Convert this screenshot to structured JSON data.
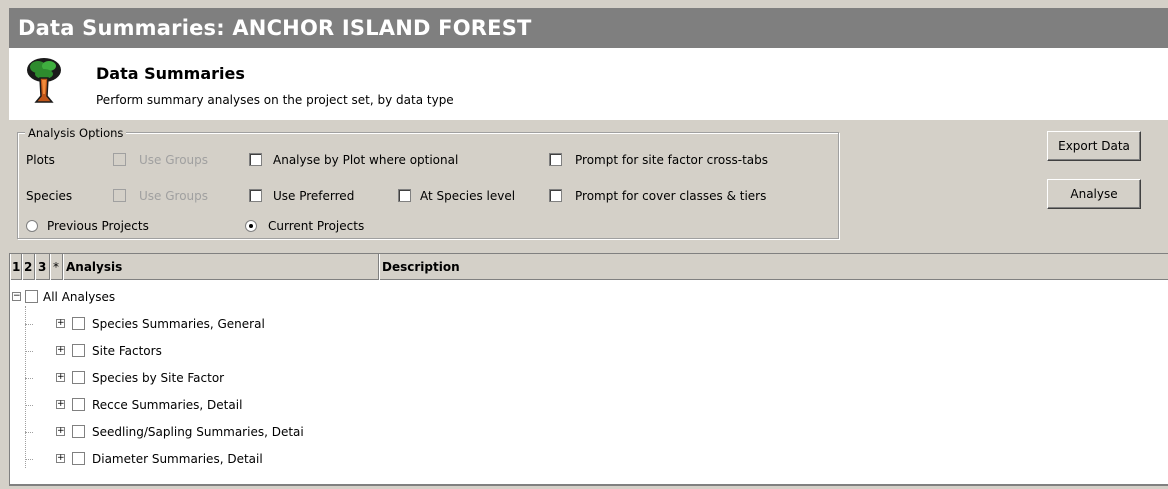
{
  "window": {
    "title": "Data Summaries: ANCHOR ISLAND FOREST"
  },
  "header": {
    "icon": "tree-icon",
    "title": "Data Summaries",
    "subtitle": "Perform summary analyses on the project set, by data type"
  },
  "options": {
    "legend": "Analysis Options",
    "plots_label": "Plots",
    "species_label": "Species",
    "plots_use_groups": {
      "label": "Use Groups",
      "checked": false,
      "enabled": false
    },
    "analyse_by_plot": {
      "label": "Analyse by Plot where optional",
      "checked": false
    },
    "prompt_site_factor": {
      "label": "Prompt for site factor cross-tabs",
      "checked": false
    },
    "species_use_groups": {
      "label": "Use Groups",
      "checked": false,
      "enabled": false
    },
    "use_preferred": {
      "label": "Use Preferred",
      "checked": false
    },
    "at_species_level": {
      "label": "At Species level",
      "checked": false
    },
    "prompt_cover": {
      "label": "Prompt for cover classes & tiers",
      "checked": false
    },
    "previous_projects": {
      "label": "Previous Projects",
      "selected": false
    },
    "current_projects": {
      "label": "Current Projects",
      "selected": true
    }
  },
  "buttons": {
    "export": "Export Data",
    "analyse": "Analyse"
  },
  "grid": {
    "columns": [
      "1",
      "2",
      "3",
      "*",
      "Analysis",
      "Description"
    ],
    "root": {
      "label": "All Analyses",
      "expanded": true,
      "checked": false
    },
    "items": [
      {
        "label": "Species Summaries, General",
        "expanded": false,
        "checked": false
      },
      {
        "label": "Site Factors",
        "expanded": false,
        "checked": false
      },
      {
        "label": "Species by Site Factor",
        "expanded": false,
        "checked": false
      },
      {
        "label": "Recce Summaries, Detail",
        "expanded": false,
        "checked": false
      },
      {
        "label": "Seedling/Sapling Summaries, Detai",
        "expanded": false,
        "checked": false
      },
      {
        "label": "Diameter Summaries, Detail",
        "expanded": false,
        "checked": false
      }
    ]
  }
}
